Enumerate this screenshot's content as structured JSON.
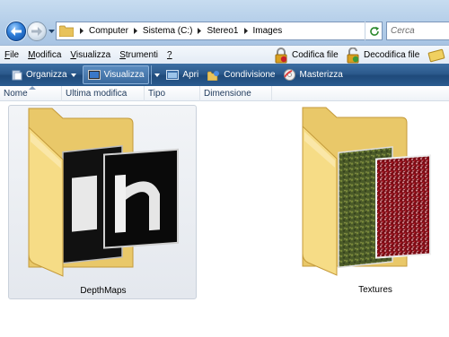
{
  "address_bar": {
    "back_icon": "arrow-left-icon",
    "forward_icon": "arrow-right-icon",
    "crumbs": [
      "Computer",
      "Sistema (C:)",
      "Stereo1",
      "Images"
    ],
    "search_placeholder": "Cerca"
  },
  "menu": {
    "items": [
      {
        "label": "File",
        "accel": "F"
      },
      {
        "label": "Modifica",
        "accel": "M"
      },
      {
        "label": "Visualizza",
        "accel": "V"
      },
      {
        "label": "Strumenti",
        "accel": "S"
      },
      {
        "label": "?",
        "accel": "?"
      }
    ],
    "encrypt_label": "Codifica file",
    "decrypt_label": "Decodifica file"
  },
  "commands": {
    "organize": "Organizza",
    "view": "Visualizza",
    "open": "Apri",
    "share": "Condivisione",
    "burn": "Masterizza"
  },
  "columns": [
    "Nome",
    "Ultima modifica",
    "Tipo",
    "Dimensione"
  ],
  "folders": [
    {
      "name": "DepthMaps",
      "selected": true
    },
    {
      "name": "Textures",
      "selected": false
    }
  ],
  "colors": {
    "command_bar": "#2c5a8c",
    "folder": "#f3d677",
    "selection": "#e4e8ee"
  }
}
